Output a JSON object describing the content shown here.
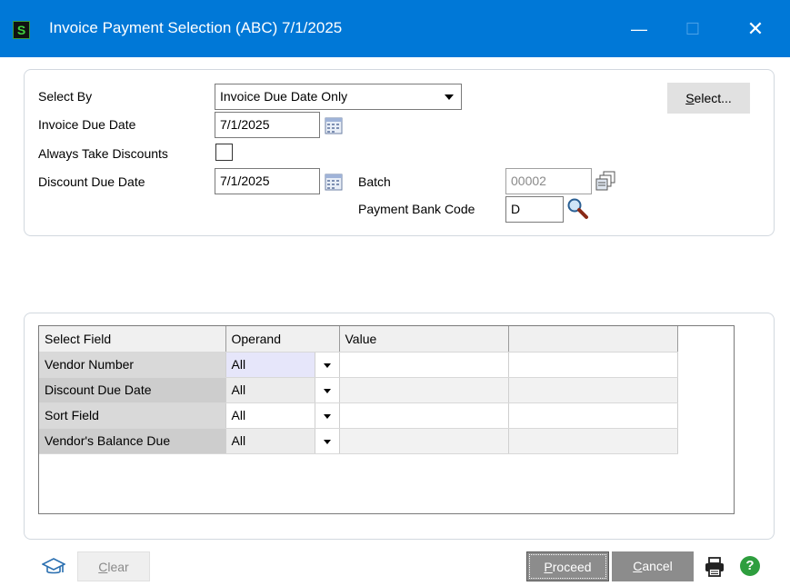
{
  "window": {
    "title": "Invoice Payment Selection (ABC) 7/1/2025",
    "app_icon_letter": "S",
    "minimize_glyph": "—",
    "maximize_glyph": "☐",
    "close_glyph": "✕"
  },
  "form": {
    "select_by_label": "Select By",
    "select_by_value": "Invoice Due Date Only",
    "invoice_due_date_label": "Invoice Due Date",
    "invoice_due_date_value": "7/1/2025",
    "always_take_discounts_label": "Always Take Discounts",
    "always_take_discounts_checked": false,
    "discount_due_date_label": "Discount Due Date",
    "discount_due_date_value": "7/1/2025",
    "batch_label": "Batch",
    "batch_value": "00002",
    "payment_bank_code_label": "Payment Bank Code",
    "payment_bank_code_value": "D",
    "select_button_prefix": "S",
    "select_button_rest": "elect..."
  },
  "grid": {
    "headers": [
      "Select Field",
      "Operand",
      "Value",
      ""
    ],
    "rows": [
      {
        "field": "Vendor Number",
        "operand": "All"
      },
      {
        "field": "Discount Due Date",
        "operand": "All"
      },
      {
        "field": "Sort Field",
        "operand": "All"
      },
      {
        "field": "Vendor's Balance Due",
        "operand": "All"
      }
    ]
  },
  "footer": {
    "clear_prefix": "C",
    "clear_rest": "lear",
    "proceed_prefix": "P",
    "proceed_rest": "roceed",
    "cancel_prefix": "C",
    "cancel_rest": "ancel",
    "help_glyph": "?"
  },
  "colors": {
    "titlebar": "#0078d7",
    "button_dark": "#8c8c8c",
    "help_green": "#2e9e3e"
  }
}
